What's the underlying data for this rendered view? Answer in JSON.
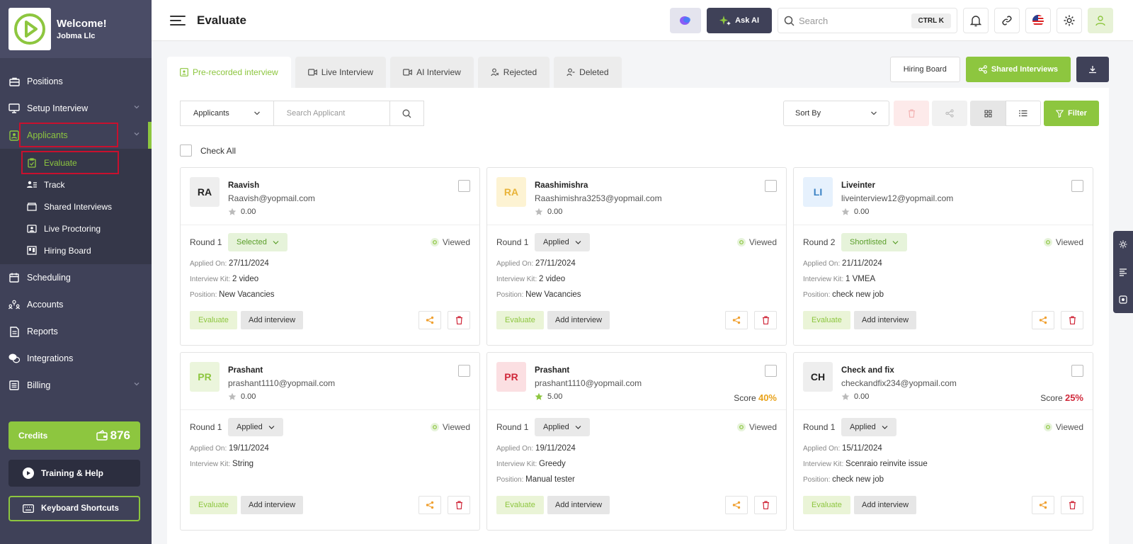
{
  "sidebar": {
    "welcome": "Welcome!",
    "company": "Jobma Llc",
    "nav": {
      "positions": "Positions",
      "setup": "Setup Interview",
      "applicants": "Applicants",
      "evaluate": "Evaluate",
      "track": "Track",
      "shared": "Shared Interviews",
      "proctoring": "Live Proctoring",
      "hiring": "Hiring Board",
      "scheduling": "Scheduling",
      "accounts": "Accounts",
      "reports": "Reports",
      "integrations": "Integrations",
      "billing": "Billing"
    },
    "credits_label": "Credits",
    "credits_value": "876",
    "training": "Training & Help",
    "keyboard": "Keyboard Shortcuts"
  },
  "topbar": {
    "title": "Evaluate",
    "ask_ai": "Ask AI",
    "search_placeholder": "Search",
    "shortcut": "CTRL K"
  },
  "tabs": {
    "prerecorded": "Pre-recorded interview",
    "live": "Live Interview",
    "ai": "AI Interview",
    "rejected": "Rejected",
    "deleted": "Deleted"
  },
  "actions": {
    "hiring_board": "Hiring Board",
    "shared_interviews": "Shared Interviews"
  },
  "filters": {
    "applicants_select": "Applicants",
    "search_placeholder": "Search Applicant",
    "sort_by": "Sort By",
    "filter": "Filter",
    "check_all": "Check All"
  },
  "labels": {
    "applied_on": "Applied On:",
    "interview_kit": "Interview Kit:",
    "position": "Position:",
    "viewed": "Viewed",
    "score": "Score",
    "evaluate": "Evaluate",
    "add_interview": "Add interview"
  },
  "cards": [
    {
      "initials": "RA",
      "name": "Raavish",
      "email": "Raavish@yopmail.com",
      "rating": "0.00",
      "round": "Round 1",
      "status": "Selected",
      "applied": "27/11/2024",
      "kit": "2 video",
      "position": "New Vacancies",
      "score": ""
    },
    {
      "initials": "RA",
      "name": "Raashimishra",
      "email": "Raashimishra3253@yopmail.com",
      "rating": "0.00",
      "round": "Round 1",
      "status": "Applied",
      "applied": "27/11/2024",
      "kit": "2 video",
      "position": "New Vacancies",
      "score": ""
    },
    {
      "initials": "LI",
      "name": "Liveinter",
      "email": "liveinterview12@yopmail.com",
      "rating": "0.00",
      "round": "Round 2",
      "status": "Shortlisted",
      "applied": "21/11/2024",
      "kit": "1 VMEA",
      "position": "check new job",
      "score": ""
    },
    {
      "initials": "PR",
      "name": "Prashant",
      "email": "prashant1110@yopmail.com",
      "rating": "0.00",
      "round": "Round 1",
      "status": "Applied",
      "applied": "19/11/2024",
      "kit": "String",
      "position": "",
      "score": ""
    },
    {
      "initials": "PR",
      "name": "Prashant",
      "email": "prashant1110@yopmail.com",
      "rating": "5.00",
      "round": "Round 1",
      "status": "Applied",
      "applied": "19/11/2024",
      "kit": "Greedy",
      "position": "Manual tester",
      "score": "40%"
    },
    {
      "initials": "CH",
      "name": "Check and fix",
      "email": "checkandfix234@yopmail.com",
      "rating": "0.00",
      "round": "Round 1",
      "status": "Applied",
      "applied": "15/11/2024",
      "kit": "Scenraio reinvite issue",
      "position": "check new job",
      "score": "25%"
    }
  ],
  "colors": {
    "accent": "#8dc63f",
    "sidebar": "#3f4158",
    "danger": "#c8102e",
    "score_orange": "#e8a21a",
    "score_red": "#d0283a"
  }
}
